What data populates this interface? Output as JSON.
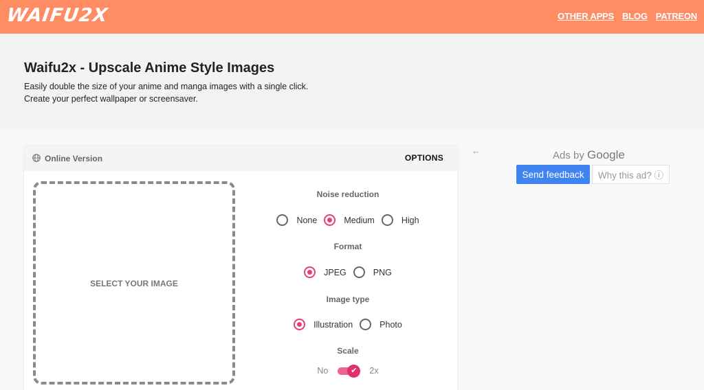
{
  "header": {
    "logo": "WAIFU2X",
    "nav": [
      "OTHER APPS",
      "BLOG",
      "PATREON"
    ]
  },
  "hero": {
    "title": "Waifu2x - Upscale Anime Style Images",
    "line1": "Easily double the size of your anime and manga images with a single click.",
    "line2": "Create your perfect wallpaper or screensaver."
  },
  "card": {
    "title": "Online Version",
    "options_label": "OPTIONS",
    "dropzone_label": "SELECT YOUR IMAGE",
    "noise": {
      "label": "Noise reduction",
      "options": [
        "None",
        "Medium",
        "High"
      ],
      "selected": "Medium"
    },
    "format": {
      "label": "Format",
      "options": [
        "JPEG",
        "PNG"
      ],
      "selected": "JPEG"
    },
    "image_type": {
      "label": "Image type",
      "options": [
        "Illustration",
        "Photo"
      ],
      "selected": "Illustration"
    },
    "scale": {
      "label": "Scale",
      "off_label": "No",
      "on_label": "2x",
      "enabled": true
    }
  },
  "ad": {
    "back_arrow": "←",
    "ads_by": "Ads by",
    "google": "Google",
    "send_feedback": "Send feedback",
    "why_ad": "Why this ad? ⓘ"
  },
  "colors": {
    "header": "#ff8c63",
    "accent": "#e63e7a",
    "button": "#3f84f0"
  }
}
